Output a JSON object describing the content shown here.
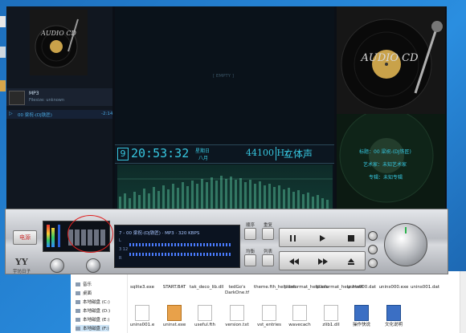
{
  "player": {
    "logo_text": "AUDIO CD",
    "playlist": {
      "item_title": "MP3",
      "item_sub": "Filesize: unknown",
      "track_line": "00  梁祝-(DJ铁匠)",
      "track_time": "-2:14"
    },
    "center_label": "[ EMPTY ]",
    "clock": {
      "index": "9",
      "time": "20:53:32",
      "weekday": "星期日",
      "month": "八月",
      "frequency": "44100 Hz",
      "mode": "立体声"
    },
    "info": {
      "title_line": "标题：00 梁祝-(DJ铁匠)",
      "artist_line": "艺术家：未知艺术家",
      "album_line": "专辑：未知专辑"
    },
    "deck": {
      "button_power": "电源",
      "brand": "宇坊日子",
      "lcd_line": "7 - 00 梁祝-(DJ铁匠) · MP3 · 320  KBPS",
      "lcd_left_marks": [
        "L",
        "3 12",
        "R"
      ],
      "side_labels": [
        "顺序",
        "重复",
        "均衡",
        "列表"
      ]
    }
  },
  "explorer": {
    "nav": [
      {
        "label": "音乐"
      },
      {
        "label": "桌面"
      },
      {
        "label": "本地磁盘 (C:)"
      },
      {
        "label": "本地磁盘 (D:)"
      },
      {
        "label": "本地磁盘 (E:)"
      },
      {
        "label": "本地磁盘 (F:)"
      }
    ],
    "files_row1": [
      "sqlite3.exe",
      "START.BAT",
      "tak_deco_lib.dll",
      "tedGo's DarkOne.tf",
      "theme.fth_help.css",
      "titleformat_help.css",
      "titleformat_help.html",
      "unins000.dat",
      "unins000.exe",
      "unins001.dat"
    ],
    "files_row2": [
      "unins001.e",
      "uninst.exe",
      "useful.fth",
      "version.txt",
      "vst_entries",
      "wavecach",
      "zlib1.dll",
      "操作快说",
      "文化说明"
    ]
  }
}
